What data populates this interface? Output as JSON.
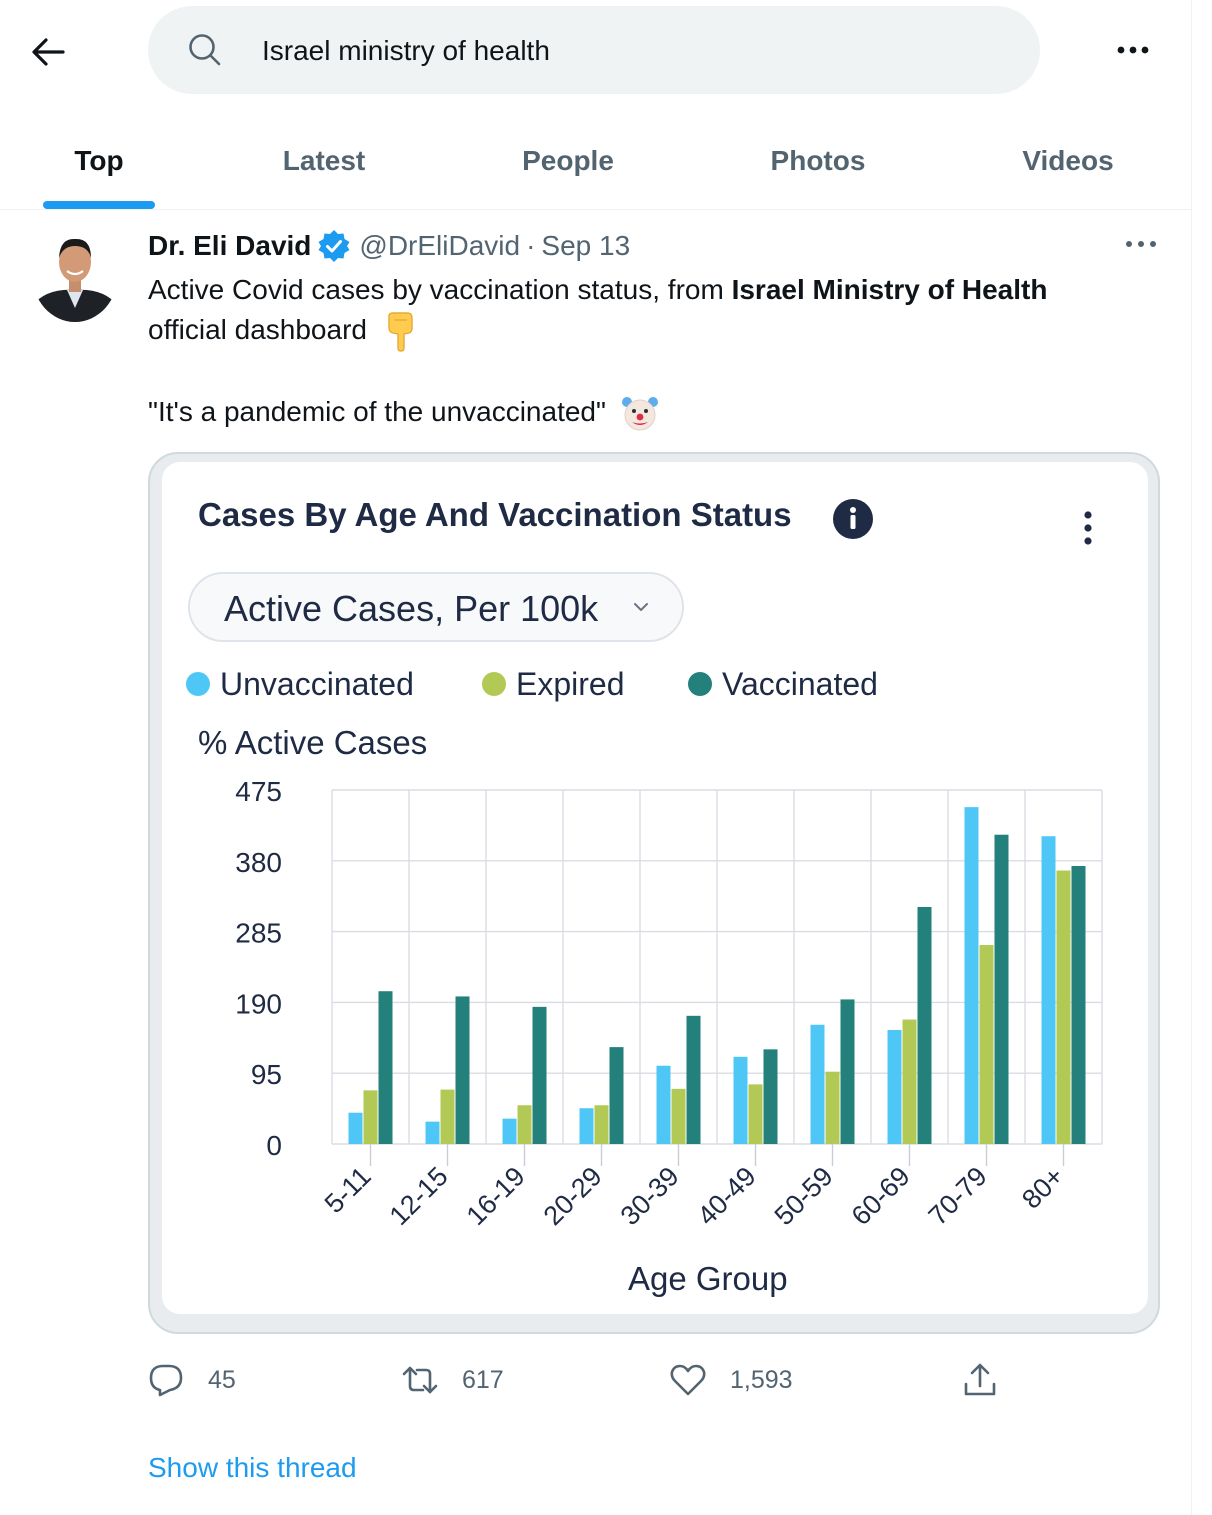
{
  "search": {
    "query": "Israel ministry of health"
  },
  "tabs": [
    {
      "label": "Top",
      "active": true
    },
    {
      "label": "Latest",
      "active": false
    },
    {
      "label": "People",
      "active": false
    },
    {
      "label": "Photos",
      "active": false
    },
    {
      "label": "Videos",
      "active": false
    }
  ],
  "tweet": {
    "author_name": "Dr. Eli David",
    "handle": "@DrEliDavid",
    "separator": "·",
    "date": "Sep 13",
    "text_part1": "Active Covid cases by vaccination status, from ",
    "text_bold": "Israel Ministry of Health",
    "text_part2": "official dashboard",
    "emoji_1": "backhand-index-pointing-down",
    "quote": "\"It's a pandemic of the unvaccinated\"",
    "emoji_2": "clown-face",
    "replies": "45",
    "retweets": "617",
    "likes": "1,593",
    "show_thread": "Show this thread"
  },
  "colors": {
    "accent": "#1d9bf0",
    "unvaccinated": "#4fc7f6",
    "expired": "#b2c956",
    "vaccinated": "#23807a",
    "chart_text": "#1f2a44"
  },
  "chart_data": {
    "type": "bar",
    "title": "Cases By Age And Vaccination Status",
    "selector": "Active Cases, Per 100k",
    "ylabel": "% Active Cases",
    "xlabel": "Age Group",
    "ylim": [
      0,
      475
    ],
    "yticks": [
      "475",
      "380",
      "285",
      "190",
      "95",
      "0"
    ],
    "grid": true,
    "legend_position": "top",
    "categories": [
      "5-11",
      "12-15",
      "16-19",
      "20-29",
      "30-39",
      "40-49",
      "50-59",
      "60-69",
      "70-79",
      "80+"
    ],
    "series": [
      {
        "name": "Unvaccinated",
        "color": "#4fc7f6",
        "values": [
          42,
          30,
          34,
          48,
          105,
          117,
          160,
          153,
          452,
          413
        ]
      },
      {
        "name": "Expired",
        "color": "#b2c956",
        "values": [
          72,
          73,
          52,
          52,
          74,
          80,
          97,
          167,
          267,
          367
        ]
      },
      {
        "name": "Vaccinated",
        "color": "#23807a",
        "values": [
          205,
          198,
          184,
          130,
          172,
          127,
          194,
          318,
          415,
          373
        ]
      }
    ]
  }
}
